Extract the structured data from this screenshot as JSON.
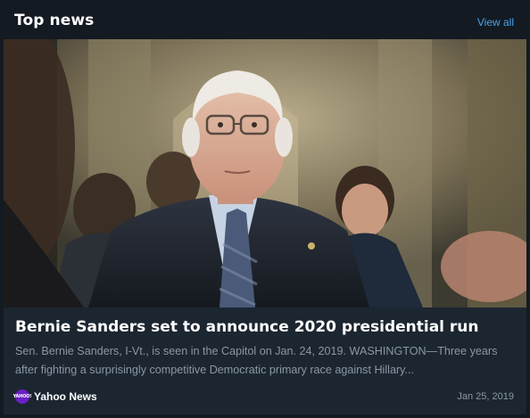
{
  "header": {
    "title": "Top news",
    "view_all_label": "View all"
  },
  "story": {
    "title": "Bernie Sanders set to announce 2020 presidential run",
    "summary": "Sen. Bernie Sanders, I-Vt., is seen in the Capitol on Jan. 24, 2019. WASHINGTON—Three years after fighting a surprisingly competitive Democratic primary race against Hillary...",
    "image_subject": "photo of Bernie Sanders in the Capitol",
    "source": {
      "name": "Yahoo News",
      "logo_text": "YAHOO!",
      "logo_color": "#6a1fc8"
    },
    "date": "Jan 25, 2019"
  },
  "colors": {
    "background": "#131a22",
    "card": "#1c2631",
    "accent_link": "#4aa4e8",
    "muted_text": "#8b97a4"
  }
}
